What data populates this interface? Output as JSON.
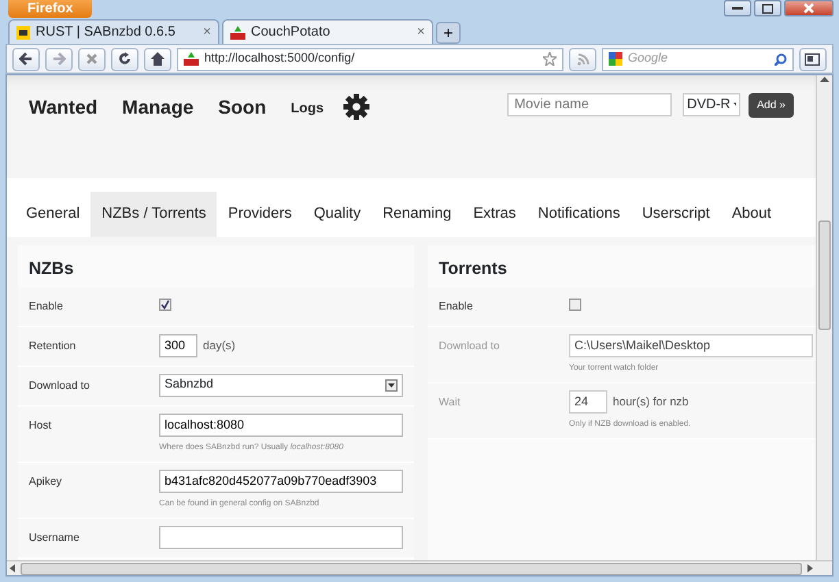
{
  "browser": {
    "menu_button": "Firefox",
    "tabs": [
      {
        "title": "RUST | SABnzbd 0.6.5",
        "selected": false,
        "close": "×"
      },
      {
        "title": "CouchPotato",
        "selected": true,
        "close": "×"
      }
    ],
    "new_tab": "+",
    "address": "http://localhost:5000/config/",
    "search": {
      "placeholder": "Google"
    }
  },
  "header": {
    "nav": [
      {
        "label": "Wanted",
        "kind": "big"
      },
      {
        "label": "Manage",
        "kind": "big"
      },
      {
        "label": "Soon",
        "kind": "big"
      },
      {
        "label": "Logs",
        "kind": "small"
      }
    ],
    "search": {
      "placeholder": "Movie name"
    },
    "quality": "DVD-R",
    "add_button": "Add »"
  },
  "config_tabs": [
    {
      "label": "General",
      "selected": false
    },
    {
      "label": "NZBs / Torrents",
      "selected": true
    },
    {
      "label": "Providers",
      "selected": false
    },
    {
      "label": "Quality",
      "selected": false
    },
    {
      "label": "Renaming",
      "selected": false
    },
    {
      "label": "Extras",
      "selected": false
    },
    {
      "label": "Notifications",
      "selected": false
    },
    {
      "label": "Userscript",
      "selected": false
    },
    {
      "label": "About",
      "selected": false
    }
  ],
  "sections": [
    {
      "title": "NZBs",
      "rows": [
        {
          "label": "Enable",
          "kind": "checkbox",
          "checked": true,
          "disabled": false
        },
        {
          "label": "Retention",
          "kind": "number",
          "value": "300",
          "unit": "day(s)",
          "disabled": false
        },
        {
          "label": "Download to",
          "kind": "select",
          "value": "Sabnzbd",
          "disabled": false
        },
        {
          "label": "Host",
          "kind": "text",
          "value": "localhost:8080",
          "hint": "Where does SABnzbd run? Usually *localhost:8080*",
          "disabled": false
        },
        {
          "label": "Apikey",
          "kind": "text",
          "value": "b431afc820d452077a09b770eadf3903",
          "hint": "Can be found in general config on SABnzbd",
          "disabled": false
        },
        {
          "label": "Username",
          "kind": "text",
          "disabled": false
        }
      ]
    },
    {
      "title": "Torrents",
      "rows": [
        {
          "label": "Enable",
          "kind": "checkbox",
          "checked": false,
          "disabled": false
        },
        {
          "label": "Download to",
          "kind": "text",
          "value": "C:\\Users\\Maikel\\Desktop",
          "hint": "Your torrent watch folder",
          "disabled": true
        },
        {
          "label": "Wait",
          "kind": "number",
          "value": "24",
          "unit": "hour(s) for nzb",
          "hint": "Only if NZB download is enabled.",
          "disabled": true
        }
      ]
    }
  ]
}
